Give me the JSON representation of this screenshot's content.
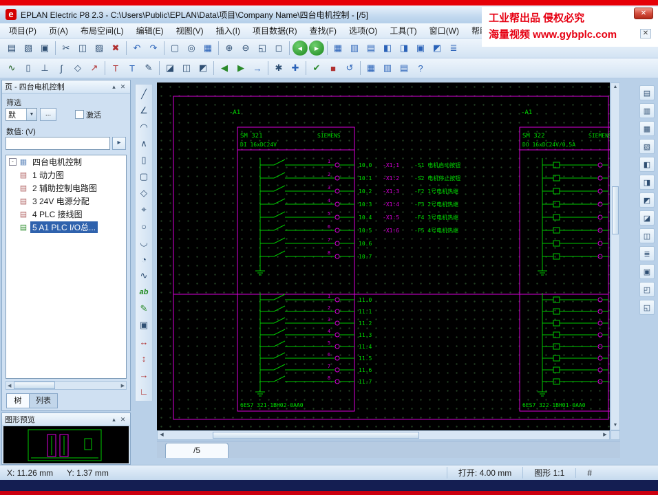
{
  "title_bar": {
    "title": "EPLAN Electric P8 2.3 - C:\\Users\\Public\\EPLAN\\Data\\项目\\Company Name\\四台电机控制 - [/5]"
  },
  "window_controls": {
    "close": "✕",
    "doc_close": "✕"
  },
  "watermark": {
    "line1": "工业帮出品 侵权必究",
    "line2": "海量视频 www.gybplc.com",
    "color": "#e60012"
  },
  "menu_bar": {
    "items": [
      "项目(P)",
      "页(A)",
      "布局空间(L)",
      "编辑(E)",
      "视图(V)",
      "插入(I)",
      "项目数据(R)",
      "查找(F)",
      "选项(O)",
      "工具(T)",
      "窗口(W)",
      "帮助(H)"
    ]
  },
  "toolbar_row1": {
    "icons": [
      {
        "name": "new-page-icon",
        "glyph": "▤"
      },
      {
        "name": "open-project-icon",
        "glyph": "▧"
      },
      {
        "name": "save-icon",
        "glyph": "▣"
      },
      {
        "sep": true
      },
      {
        "name": "cut-icon",
        "glyph": "✂"
      },
      {
        "name": "copy-icon",
        "glyph": "◫"
      },
      {
        "name": "paste-icon",
        "glyph": "▨"
      },
      {
        "name": "delete-icon",
        "glyph": "✖",
        "color": "#b03030"
      },
      {
        "sep": true
      },
      {
        "name": "undo-icon",
        "glyph": "↶",
        "color": "#2a62b8"
      },
      {
        "name": "redo-icon",
        "glyph": "↷",
        "color": "#2a62b8"
      },
      {
        "sep": true
      },
      {
        "name": "select-icon",
        "glyph": "▢"
      },
      {
        "name": "search-icon",
        "glyph": "◎"
      },
      {
        "name": "calculator-icon",
        "glyph": "▦",
        "color": "#2a62b8"
      },
      {
        "sep": true
      },
      {
        "name": "zoom-in-icon",
        "glyph": "⊕"
      },
      {
        "name": "zoom-out-icon",
        "glyph": "⊖"
      },
      {
        "name": "zoom-window-icon",
        "glyph": "◱"
      },
      {
        "name": "zoom-fit-icon",
        "glyph": "◻"
      },
      {
        "sep": true
      },
      {
        "name": "back-icon",
        "glyph": "◀",
        "cls": "green"
      },
      {
        "name": "forward-icon",
        "glyph": "▶",
        "cls": "green"
      },
      {
        "sep": true
      },
      {
        "name": "plc-navigator-icon",
        "glyph": "▦",
        "color": "#2a62b8"
      },
      {
        "name": "device-navigator-icon",
        "glyph": "▥",
        "color": "#2a62b8"
      },
      {
        "name": "terminal-navigator-icon",
        "glyph": "▤",
        "color": "#2a62b8"
      },
      {
        "name": "cable-navigator-icon",
        "glyph": "◧",
        "color": "#2a62b8"
      },
      {
        "name": "connections-icon",
        "glyph": "◨",
        "color": "#2a62b8"
      },
      {
        "name": "reports-icon",
        "glyph": "▣",
        "color": "#2a62b8"
      },
      {
        "name": "parts-icon",
        "glyph": "◩",
        "color": "#2a62b8"
      },
      {
        "name": "layers-icon",
        "glyph": "≣",
        "color": "#2a62b8"
      }
    ]
  },
  "toolbar_row2": {
    "icons": [
      {
        "name": "symbol-icon",
        "glyph": "∿",
        "color": "#206020"
      },
      {
        "name": "device-box-icon",
        "glyph": "▯"
      },
      {
        "name": "terminal-icon",
        "glyph": "⊥"
      },
      {
        "name": "cable-definition-icon",
        "glyph": "∫"
      },
      {
        "name": "shield-icon",
        "glyph": "◇"
      },
      {
        "name": "interruption-point-icon",
        "glyph": "↗",
        "color": "#b03030"
      },
      {
        "sep": true
      },
      {
        "name": "text-icon",
        "glyph": "T",
        "color": "#b03030"
      },
      {
        "name": "path-text-icon",
        "glyph": "T",
        "color": "#2a62b8"
      },
      {
        "name": "graphic-icon",
        "glyph": "✎"
      },
      {
        "sep": true
      },
      {
        "name": "page-macro-icon",
        "glyph": "◪"
      },
      {
        "name": "window-macro-icon",
        "glyph": "◫"
      },
      {
        "name": "symbol-macro-icon",
        "glyph": "◩"
      },
      {
        "sep": true
      },
      {
        "name": "prev-page-icon",
        "glyph": "◀",
        "color": "#2a8a2a"
      },
      {
        "name": "next-page-icon",
        "glyph": "▶",
        "color": "#2a8a2a"
      },
      {
        "name": "goto-page-icon",
        "glyph": "→",
        "color": "#2a62b8"
      },
      {
        "sep": true
      },
      {
        "name": "edit-properties-icon",
        "glyph": "✱"
      },
      {
        "name": "new-device-icon",
        "glyph": "✚",
        "color": "#2a62b8"
      },
      {
        "sep": true
      },
      {
        "name": "check-project-icon",
        "glyph": "✔",
        "color": "#2a8a2a"
      },
      {
        "name": "messages-icon",
        "glyph": "■",
        "color": "#b03030"
      },
      {
        "name": "update-icon",
        "glyph": "↺",
        "color": "#2a62b8"
      },
      {
        "sep": true
      },
      {
        "name": "table-edit-icon",
        "glyph": "▦",
        "color": "#2a62b8"
      },
      {
        "name": "form-edit-icon",
        "glyph": "▥",
        "color": "#2a62b8"
      },
      {
        "name": "frame-edit-icon",
        "glyph": "▤",
        "color": "#2a62b8"
      },
      {
        "name": "help-icon",
        "glyph": "?",
        "color": "#2a62b8"
      }
    ]
  },
  "drawing_toolbar": {
    "icons": [
      {
        "name": "line-icon",
        "glyph": "╱"
      },
      {
        "name": "angle-icon",
        "glyph": "∠"
      },
      {
        "name": "arc-icon",
        "glyph": "◠"
      },
      {
        "name": "polyline-icon",
        "glyph": "∧"
      },
      {
        "name": "rectangle-icon",
        "glyph": "▯"
      },
      {
        "name": "rounded-rectangle-icon",
        "glyph": "▢"
      },
      {
        "name": "polygon-icon",
        "glyph": "◇"
      },
      {
        "name": "target-point-icon",
        "glyph": "⌖"
      },
      {
        "name": "circle-icon",
        "glyph": "○"
      },
      {
        "name": "arc-segment-icon",
        "glyph": "◡"
      },
      {
        "name": "sector-icon",
        "glyph": "◔"
      },
      {
        "name": "spline-icon",
        "glyph": "∿"
      },
      {
        "name": "text-tool-icon",
        "glyph": "ab",
        "cls": "abicon"
      },
      {
        "name": "edit-text-icon",
        "glyph": "✎",
        "color": "#2a8a2a"
      },
      {
        "name": "image-icon",
        "glyph": "▣"
      },
      {
        "name": "dimension-linear-icon",
        "glyph": "↔",
        "color": "#b03030"
      },
      {
        "name": "dimension-vertical-icon",
        "glyph": "↕",
        "color": "#b03030"
      },
      {
        "name": "dimension-continued-icon",
        "glyph": "→",
        "color": "#b03030"
      },
      {
        "name": "dimension-angle-icon",
        "glyph": "∟",
        "color": "#b03030"
      }
    ]
  },
  "right_toolbar": {
    "icons": [
      {
        "name": "page-navigator-toggle-icon",
        "glyph": "▤"
      },
      {
        "name": "graphical-preview-toggle-icon",
        "glyph": "▥"
      },
      {
        "name": "device-navigator-toggle-icon",
        "glyph": "▦"
      },
      {
        "name": "plc-navigator-toggle-icon",
        "glyph": "▧"
      },
      {
        "name": "terminal-navigator-toggle-icon",
        "glyph": "◧"
      },
      {
        "name": "cable-navigator-toggle-icon",
        "glyph": "◨"
      },
      {
        "name": "connection-navigator-toggle-icon",
        "glyph": "◩"
      },
      {
        "name": "parts-navigator-toggle-icon",
        "glyph": "◪"
      },
      {
        "name": "macro-navigator-toggle-icon",
        "glyph": "◫"
      },
      {
        "name": "layers-toggle-icon",
        "glyph": "≣"
      },
      {
        "name": "bookmarks-toggle-icon",
        "glyph": "▣"
      },
      {
        "name": "properties-toggle-icon",
        "glyph": "◰"
      },
      {
        "name": "messages-toggle-icon",
        "glyph": "◱"
      }
    ]
  },
  "page_navigator": {
    "title": "页 - 四台电机控制",
    "filter_label": "筛选",
    "filter_value": "默",
    "browse_label": "...",
    "active_label": "激活",
    "value_label": "数值: (V)",
    "value_text": "",
    "tabs": [
      "树",
      "列表"
    ],
    "tree": {
      "root": "四台电机控制",
      "items": [
        {
          "label": "1 动力图"
        },
        {
          "label": "2 辅助控制电路图"
        },
        {
          "label": "3 24V 电源分配"
        },
        {
          "label": "4 PLC 接线图"
        },
        {
          "label": "5 A1 PLC I/O总...",
          "selected": true
        }
      ]
    }
  },
  "preview": {
    "title": "图形预览"
  },
  "page_tab": "/5",
  "statusbar": {
    "x": "X: 11.26 mm",
    "y": "Y: 1.37 mm",
    "grid": "打开: 4.00 mm",
    "scale": "图形 1:1",
    "hash": "#"
  },
  "schematic": {
    "colors": {
      "line": "#00cc00",
      "text": "#00dd00",
      "accent": "#dd00dd"
    },
    "left_module": {
      "tag": "-A1",
      "name": "SM 321",
      "type": "DI 16xDC24V",
      "vendor": "SIEMENS",
      "part": "6ES7 321-1BH02-0AA0",
      "group1": [
        {
          "addr": "10.0",
          "pin": "1",
          "terminal": "-X1:1",
          "note": "-S1 电机启动按钮"
        },
        {
          "addr": "10.1",
          "pin": "2",
          "terminal": "-X1:2",
          "note": "-S2 电机停止按钮"
        },
        {
          "addr": "10.2",
          "pin": "3",
          "terminal": "-X1:3",
          "note": "-F2 1号电机热继"
        },
        {
          "addr": "10.3",
          "pin": "4",
          "terminal": "-X1:4",
          "note": "-F3 2号电机热继"
        },
        {
          "addr": "10.4",
          "pin": "5",
          "terminal": "-X1:5",
          "note": "-F4 3号电机热继"
        },
        {
          "addr": "10.5",
          "pin": "6",
          "terminal": "-X1:6",
          "note": "-F5 4号电机热继"
        },
        {
          "addr": "10.6",
          "pin": "7",
          "terminal": "",
          "note": ""
        },
        {
          "addr": "10.7",
          "pin": "8",
          "terminal": "",
          "note": ""
        }
      ],
      "group2": [
        {
          "addr": "11.0",
          "pin": "1"
        },
        {
          "addr": "11.1",
          "pin": "2"
        },
        {
          "addr": "11.2",
          "pin": "3"
        },
        {
          "addr": "11.3",
          "pin": "4"
        },
        {
          "addr": "11.4",
          "pin": "5"
        },
        {
          "addr": "11.5",
          "pin": "6"
        },
        {
          "addr": "11.6",
          "pin": "7"
        },
        {
          "addr": "11.7",
          "pin": "8"
        }
      ]
    },
    "right_module": {
      "tag": "-A1",
      "name": "SM 322",
      "type": "DO 16xDC24V/0,5A",
      "vendor": "SIEMENS",
      "part": "6ES7 322-1BH01-0AA0",
      "outputs1": 8,
      "outputs2": 8
    }
  }
}
